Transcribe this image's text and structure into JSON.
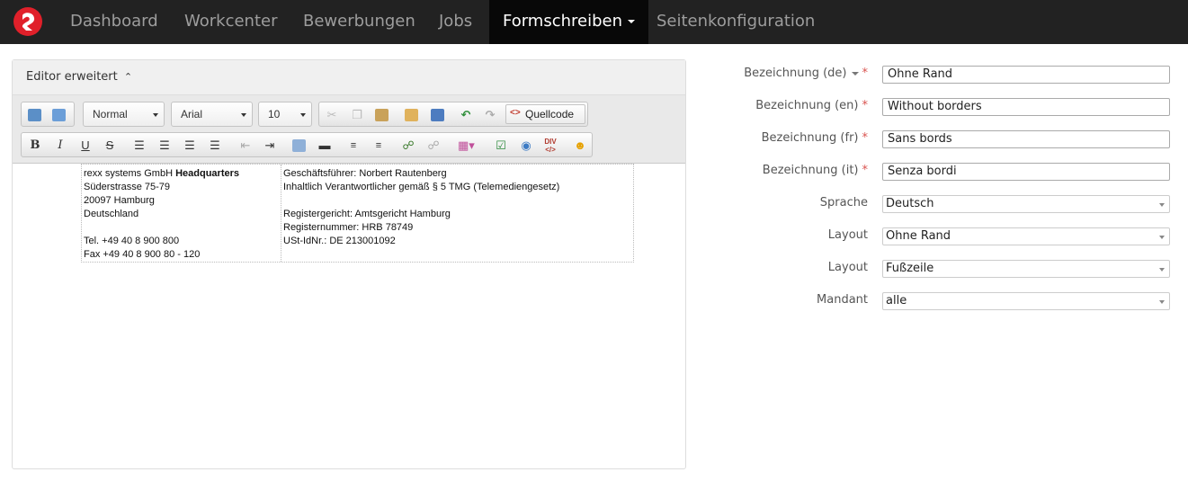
{
  "nav": {
    "logo_icon": "rexx-logo-icon",
    "items": [
      {
        "label": "Dashboard"
      },
      {
        "label": "Workcenter"
      },
      {
        "label": "Bewerbungen"
      },
      {
        "label": "Jobs"
      },
      {
        "label": "Formschreiben",
        "active": true
      },
      {
        "label": "Seitenkonfiguration"
      }
    ]
  },
  "editor": {
    "title": "Editor erweitert",
    "title_icon": "double-chevron-up-icon",
    "format_value": "Normal",
    "font_value": "Arial",
    "size_value": "10",
    "source_label": "Quellcode",
    "content": {
      "left_lines": [
        {
          "text": "rexx systems GmbH ",
          "bold": "Headquarters"
        },
        {
          "text": "Süderstrasse 75-79"
        },
        {
          "text": "20097 Hamburg"
        },
        {
          "text": "Deutschland"
        },
        {
          "text": ""
        },
        {
          "text": "Tel. +49 40 8 900 800"
        },
        {
          "text": "Fax +49 40 8 900 80 - 120"
        }
      ],
      "right_lines": [
        {
          "text": "Geschäftsführer: Norbert Rautenberg"
        },
        {
          "text": "Inhaltlich Verantwortlicher gemäß § 5 TMG (Telemediengesetz)"
        },
        {
          "text": ""
        },
        {
          "text": "Registergericht: Amtsgericht Hamburg"
        },
        {
          "text": "Registernummer: HRB 78749"
        },
        {
          "text": "USt-IdNr.: DE 213001092"
        }
      ]
    }
  },
  "form": {
    "fields": [
      {
        "label": "Bezeichnung (de)",
        "value": "Ohne Rand",
        "required": "*",
        "type": "text",
        "lang_dropdown": true
      },
      {
        "label": "Bezeichnung (en)",
        "value": "Without borders",
        "required": "*",
        "type": "text"
      },
      {
        "label": "Bezeichnung (fr)",
        "value": "Sans bords",
        "required": "*",
        "type": "text"
      },
      {
        "label": "Bezeichnung (it)",
        "value": "Senza bordi",
        "required": "*",
        "type": "text"
      },
      {
        "label": "Sprache",
        "value": "Deutsch",
        "type": "select"
      },
      {
        "label": "Layout",
        "value": "Ohne Rand",
        "type": "select"
      },
      {
        "label": "Layout",
        "value": "Fußzeile",
        "type": "select"
      },
      {
        "label": "Mandant",
        "value": "alle",
        "type": "select"
      }
    ]
  },
  "colors": {
    "navbar": "#222222",
    "nav_active": "#080808",
    "logo": "#e0202a",
    "required": "#d9534f"
  }
}
